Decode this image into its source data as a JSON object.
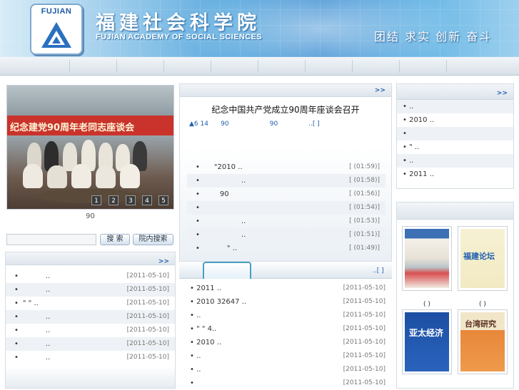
{
  "header": {
    "logo_text": "FUJIAN",
    "title": "福建社会科学院",
    "subtitle": "FUJIAN ACADEMY OF SOCIAL SCIENCES",
    "slogan": "团结 求实 创新 奋斗"
  },
  "slideshow": {
    "banner": "纪念建党90周年老同志座谈会",
    "pages": [
      "1",
      "2",
      "3",
      "4",
      "5"
    ],
    "caption": "90"
  },
  "search": {
    "button": "搜 索",
    "site_button": "院内搜索"
  },
  "left_list": {
    "more": ">>",
    "items": [
      {
        "text": "..",
        "date": "[2011-05-10]"
      },
      {
        "text": "..",
        "date": "[2011-05-10]"
      },
      {
        "text": "\"     \"     ..",
        "date": "[2011-05-10]"
      },
      {
        "text": "..",
        "date": "[2011-05-10]"
      },
      {
        "text": "..",
        "date": "[2011-05-10]"
      },
      {
        "text": "..",
        "date": "[2011-05-10]"
      },
      {
        "text": "..",
        "date": "[2011-05-10]"
      }
    ]
  },
  "center_news": {
    "more": ">>",
    "headline": "纪念中国共产党成立90周年座谈会召开",
    "summary": "▲6 14      90                    90               ..[ ]",
    "items": [
      {
        "text": "\"2010          ..",
        "time": "[  (01:59)]"
      },
      {
        "text": "..",
        "time": "[  (01:58)]"
      },
      {
        "text": "90",
        "time": "[  (01:56)]"
      },
      {
        "text": "",
        "time": "[  (01:54)]"
      },
      {
        "text": "..",
        "time": "[  (01:53)]"
      },
      {
        "text": "..",
        "time": "[  (01:51)]"
      },
      {
        "text": "\"     ..",
        "time": "[  (01:49)]"
      }
    ]
  },
  "center_tabs": {
    "more": "..[ ]",
    "items": [
      {
        "text": "• 2011              ..",
        "date": "[2011-05-10]"
      },
      {
        "text": "• 2010              32647  ..",
        "date": "[2011-05-10]"
      },
      {
        "text": "•                        ..",
        "date": "[2011-05-10]"
      },
      {
        "text": "•        \"    \"        4..",
        "date": "[2011-05-10]"
      },
      {
        "text": "•   2010              ..",
        "date": "[2011-05-10]"
      },
      {
        "text": "•                        ..",
        "date": "[2011-05-10]"
      },
      {
        "text": "•                 ..",
        "date": "[2011-05-10]"
      },
      {
        "text": "•",
        "date": "[2011-05-10]"
      }
    ]
  },
  "right_list": {
    "more": ">>",
    "items": [
      "•            ..",
      "• 2010          ..",
      "•",
      "•      \"      ..",
      "•            ..",
      "•         2011 .."
    ]
  },
  "magazines": {
    "captions": [
      "(      )",
      "(      )"
    ],
    "cover_titles": [
      "福建论坛",
      "亚太经济",
      "台湾研究"
    ]
  }
}
